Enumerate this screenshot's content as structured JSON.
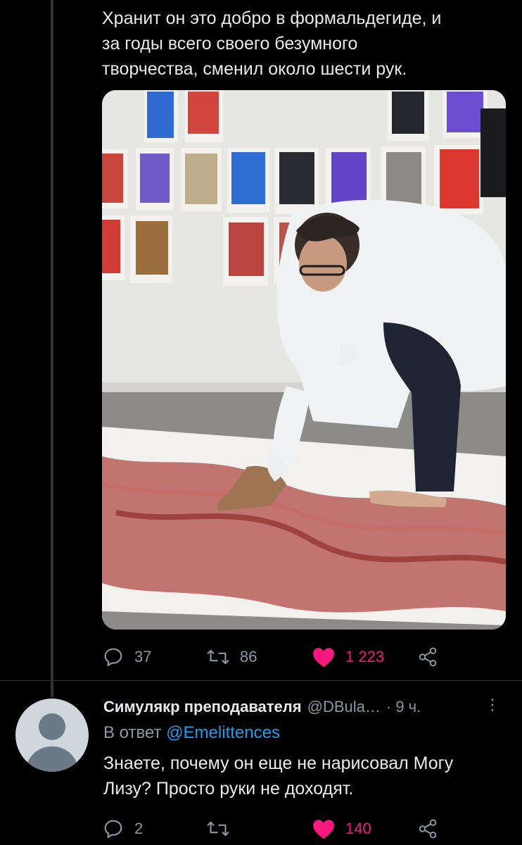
{
  "tweet": {
    "text": "Хранит он это добро в формальдегиде, и\nза годы всего своего безумного\nтворчества, сменил около шести рук.",
    "media_alt": "photo",
    "stats": {
      "replies": "37",
      "retweets": "86",
      "likes": "1 223"
    }
  },
  "reply": {
    "name": "Симулякр преподавателя",
    "handle": "@DBula…",
    "time": "· 9 ч.",
    "more": "⋮",
    "reply_prefix": "В ответ",
    "reply_mention": "@Emelittences",
    "text": "Знаете, почему он еще не нарисовал Могу\nЛизу? Просто руки не доходят.",
    "stats": {
      "replies": "2",
      "retweets": "",
      "likes": "140"
    }
  },
  "colors": {
    "background": "#000000",
    "text": "#e7e9ea",
    "muted": "#8b98a5",
    "like": "#f91880",
    "link": "#1d9bf0"
  },
  "icons": [
    "reply-icon",
    "retweet-icon",
    "heart-filled-icon",
    "share-icon",
    "more-icon",
    "avatar-placeholder-icon"
  ]
}
